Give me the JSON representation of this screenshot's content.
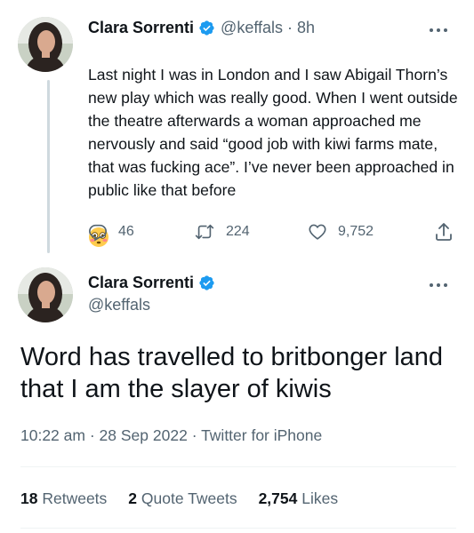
{
  "reply_tweet": {
    "author_name": "Clara Sorrenti",
    "handle": "@keffals",
    "separator": "·",
    "time_ago": "8h",
    "text": "Last night I was in London and I saw Abigail Thorn’s new play which was really good. When I went outside the theatre afterwards a woman approached me nervously and said “good job with kiwi farms mate, that was fucking ace”. I’ve never been approached in public like that before",
    "emoji": "😳",
    "replies": "46",
    "retweets": "224",
    "likes": "9,752"
  },
  "main_tweet": {
    "author_name": "Clara Sorrenti",
    "handle": "@keffals",
    "text": "Word has travelled to britbonger land that I am the slayer of kiwis",
    "time": "10:22 am",
    "separator": "·",
    "date": "28 Sep 2022",
    "source": "Twitter for iPhone",
    "stats": {
      "retweets_count": "18",
      "retweets_label": "Retweets",
      "quotes_count": "2",
      "quotes_label": "Quote Tweets",
      "likes_count": "2,754",
      "likes_label": "Likes"
    }
  },
  "icons": [
    "avatar",
    "verified-badge-icon",
    "more-options-icon",
    "reply-icon",
    "retweet-icon",
    "like-icon",
    "share-icon"
  ],
  "colors": {
    "verified": "#1d9bf0",
    "text_primary": "#0f1419",
    "text_secondary": "#536471",
    "thread_line": "#cfd9de",
    "divider": "#eff3f4"
  }
}
